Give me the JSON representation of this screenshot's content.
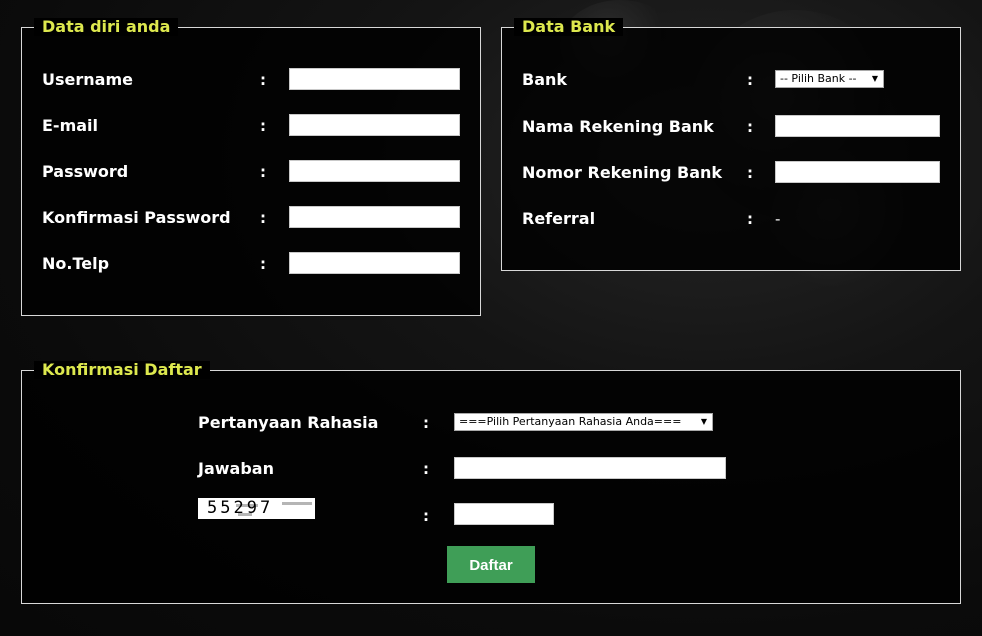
{
  "personal": {
    "legend": "Data diri anda",
    "fields": [
      {
        "label": "Username",
        "value": ""
      },
      {
        "label": "E-mail",
        "value": ""
      },
      {
        "label": "Password",
        "value": ""
      },
      {
        "label": "Konfirmasi Password",
        "value": ""
      },
      {
        "label": "No.Telp",
        "value": ""
      }
    ]
  },
  "bank": {
    "legend": "Data Bank",
    "bank_label": "Bank",
    "bank_select": "-- Pilih Bank --",
    "account_name_label": "Nama Rekening Bank",
    "account_number_label": "Nomor Rekening Bank",
    "referral_label": "Referral",
    "referral_value": "-"
  },
  "confirm": {
    "legend": "Konfirmasi Daftar",
    "question_label": "Pertanyaan Rahasia",
    "question_select": "===Pilih Pertanyaan Rahasia Anda===",
    "answer_label": "Jawaban",
    "captcha_text": "55297",
    "submit_label": "Daftar"
  },
  "colon": ":",
  "colors": {
    "legend": "#dde84e",
    "button": "#3f9e57",
    "border": "#d8d8d8"
  }
}
